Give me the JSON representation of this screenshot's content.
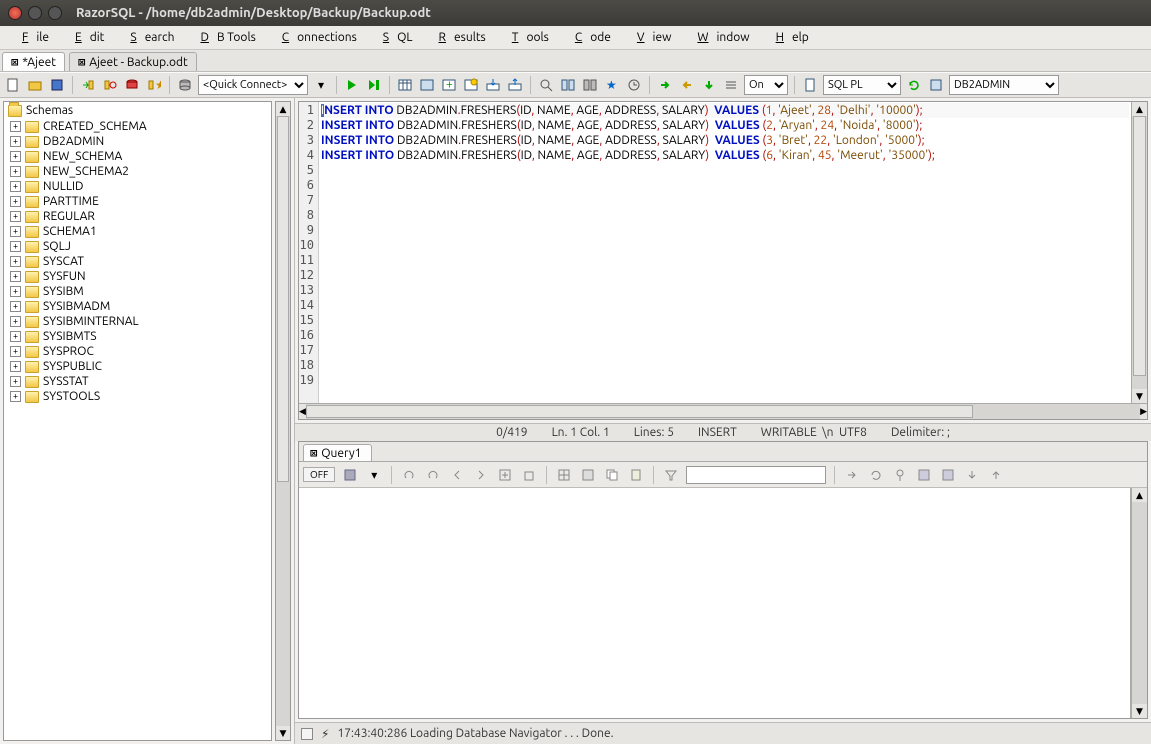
{
  "title": "RazorSQL - /home/db2admin/Desktop/Backup/Backup.odt",
  "menubar": [
    "File",
    "Edit",
    "Search",
    "DB Tools",
    "Connections",
    "SQL",
    "Results",
    "Tools",
    "Code",
    "View",
    "Window",
    "Help"
  ],
  "tabs": [
    {
      "label": "*Ajeet"
    },
    {
      "label": "Ajeet - Backup.odt"
    }
  ],
  "toolbar": {
    "quick_connect": "<Quick Connect>",
    "on": "On",
    "lang": "SQL PL",
    "schema": "DB2ADMIN"
  },
  "nav": {
    "root": "Schemas",
    "items": [
      "CREATED_SCHEMA",
      "DB2ADMIN",
      "NEW_SCHEMA",
      "NEW_SCHEMA2",
      "NULLID",
      "PARTTIME",
      "REGULAR",
      "SCHEMA1",
      "SQLJ",
      "SYSCAT",
      "SYSFUN",
      "SYSIBM",
      "SYSIBMADM",
      "SYSIBMINTERNAL",
      "SYSIBMTS",
      "SYSPROC",
      "SYSPUBLIC",
      "SYSSTAT",
      "SYSTOOLS"
    ]
  },
  "sql_rows": [
    {
      "id": 1,
      "name": "'Ajeet'",
      "age": 28,
      "addr": "'Delhi'",
      "sal": "'10000'"
    },
    {
      "id": 2,
      "name": "'Aryan'",
      "age": 24,
      "addr": "'Noida'",
      "sal": "'8000'"
    },
    {
      "id": 3,
      "name": "'Bret'",
      "age": 22,
      "addr": "'London'",
      "sal": "'5000'"
    },
    {
      "id": 6,
      "name": "'Kiran'",
      "age": 45,
      "addr": "'Meerut'",
      "sal": "'35000'"
    }
  ],
  "gutter_lines": 19,
  "status": {
    "pos": "0/419",
    "lncol": "Ln. 1 Col. 1",
    "lines": "Lines: 5",
    "mode": "INSERT",
    "write": "WRITABLE",
    "eol": "\\n",
    "enc": "UTF8",
    "delim": "Delimiter: ;"
  },
  "query_tab": "Query1",
  "qtoolbar_off": "OFF",
  "qtoolbar_dd": "",
  "bottom_status": "17:43:40:286 Loading Database Navigator . . . Done."
}
